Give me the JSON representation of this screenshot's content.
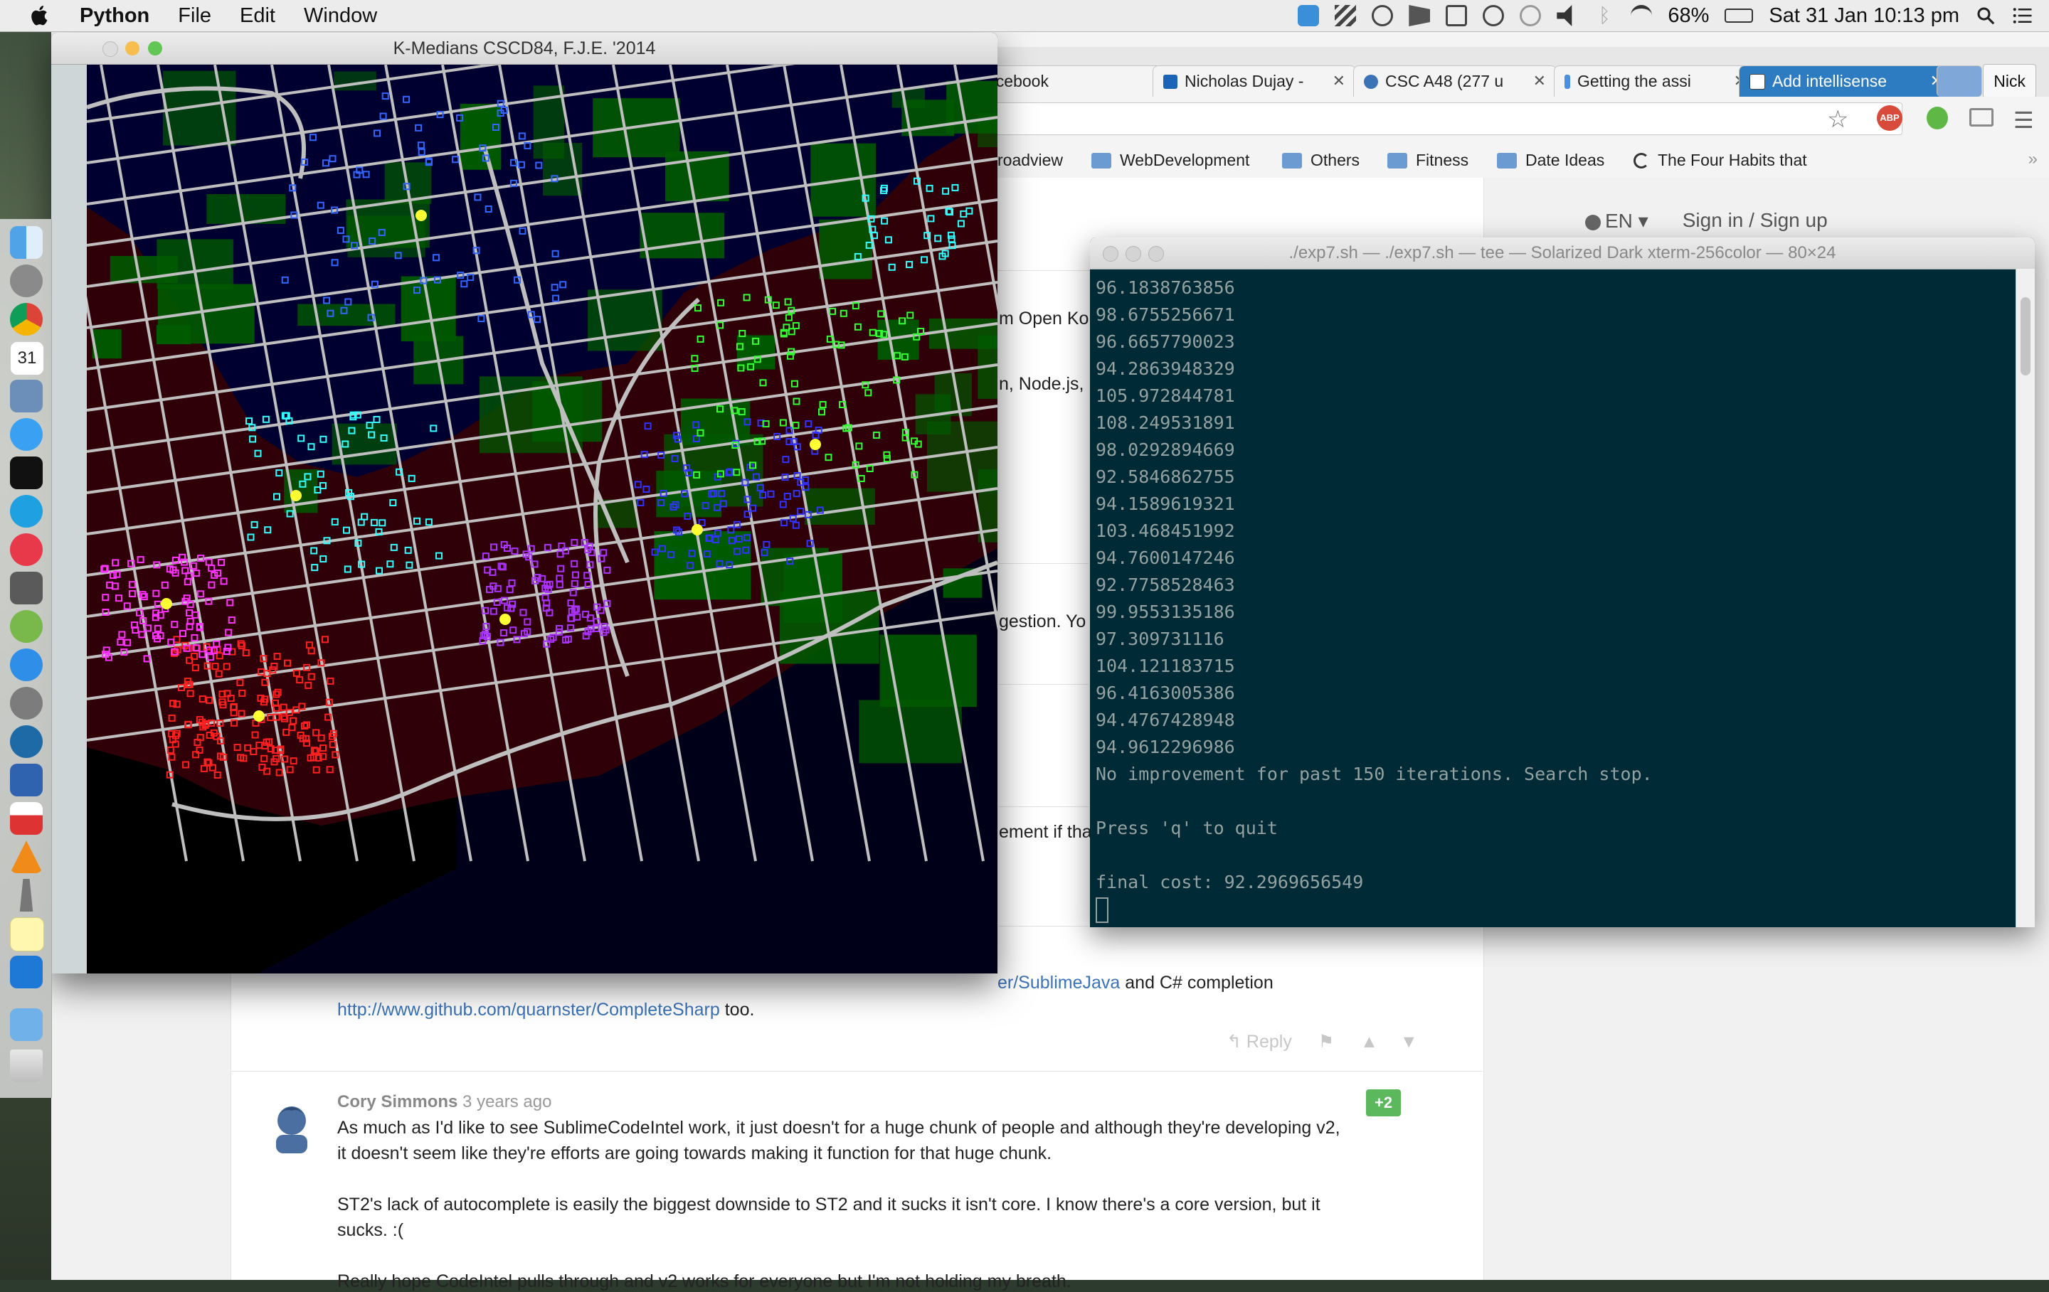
{
  "menubar": {
    "app_name": "Python",
    "items": [
      "File",
      "Edit",
      "Window"
    ],
    "battery": "68%",
    "datetime": "Sat 31 Jan  10:13 pm"
  },
  "browser": {
    "tabs": [
      {
        "label": "acebook"
      },
      {
        "label": "Nicholas Dujay -"
      },
      {
        "label": "CSC A48 (277 u"
      },
      {
        "label": "Getting the assi"
      },
      {
        "label": "Add intellisense",
        "active": true
      }
    ],
    "user_button": "Nick",
    "bookmarks": [
      "roadview",
      "WebDevelopment",
      "Others",
      "Fitness",
      "Date Ideas",
      "The Four Habits that"
    ],
    "header_right": {
      "language": "EN",
      "signin": "Sign in / Sign up"
    },
    "fragments": {
      "f1": "m Open Ko",
      "f2": "n, Node.js,",
      "f3": "gestion.  Yo",
      "f4": "ement if tha"
    },
    "comment1": {
      "line1_link": "er/SublimeJava",
      "line1_rest": " and C# completion",
      "line2_link": "http://www.github.com/quarnster/CompleteSharp",
      "line2_rest": " too.",
      "reply": "Reply"
    },
    "comment2": {
      "author": "Cory Simmons",
      "time": "3 years ago",
      "votes": "+2",
      "p1a": "As much as I'd like to see SublimeCodeIntel work, it just doesn't for a huge chunk of people and although they're developing v2,",
      "p1b": "it doesn't seem like they're efforts are going towards making it function for that huge chunk.",
      "p2a": "ST2's lack of autocomplete is easily the biggest downside to ST2 and it sucks it isn't core. I know there's a core version, but it",
      "p2b": "sucks. :(",
      "p3": "Really hope CodeIntel pulls through and v2 works for everyone but I'm not holding my breath."
    }
  },
  "terminal": {
    "title": "./exp7.sh — ./exp7.sh — tee — Solarized Dark xterm-256color — 80×24",
    "lines": [
      "96.1838763856",
      "98.6755256671",
      "96.6657790023",
      "94.2863948329",
      "105.972844781",
      "108.249531891",
      "98.0292894669",
      "92.5846862755",
      "94.1589619321",
      "103.468451992",
      "94.7600147246",
      "92.7758528463",
      "99.9553135186",
      "97.309731116",
      "104.121183715",
      "96.4163005386",
      "94.4767428948",
      "94.9612296986",
      "No improvement for past 150 iterations. Search stop.",
      "",
      "Press 'q' to quit",
      "",
      "final cost: 92.2969656549"
    ]
  },
  "mapwindow": {
    "title": "K-Medians CSCD84, F.J.E. '2014"
  },
  "colors": {
    "map_water": "#00002a",
    "map_land": "#300000",
    "map_green": "#005a00",
    "road": "#bfbfbf",
    "median_point": "#ffff33",
    "terminal_bg": "#002b36",
    "terminal_fg": "#93a1a1"
  }
}
